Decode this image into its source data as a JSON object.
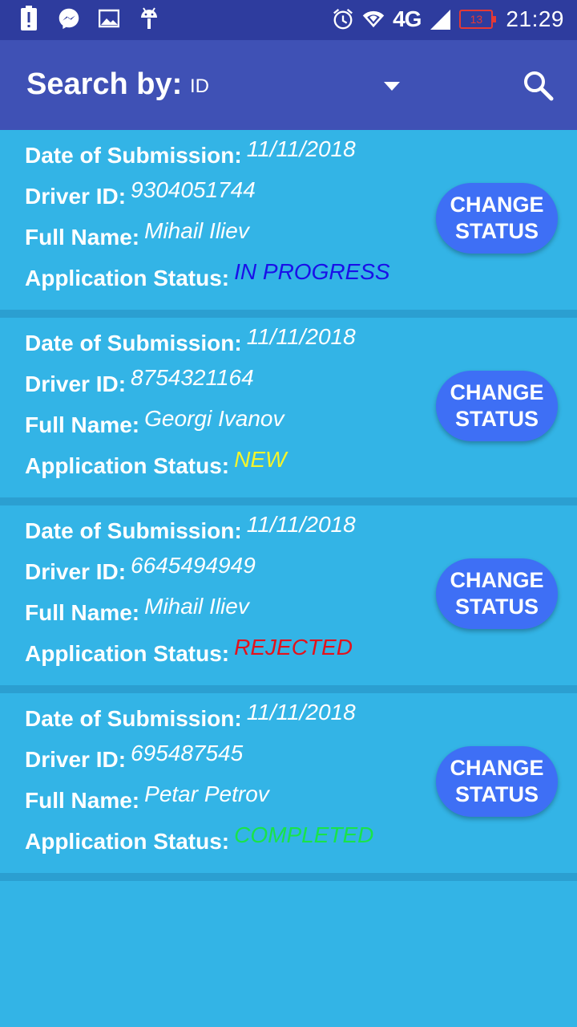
{
  "status_bar": {
    "time": "21:29",
    "network": "4G",
    "battery": "13",
    "icons": [
      "alert-icon",
      "messenger-icon",
      "image-icon",
      "android-icon",
      "alarm-icon",
      "wifi-icon",
      "signal-icon",
      "battery-icon"
    ]
  },
  "app_bar": {
    "title": "Search by:",
    "search_field": "ID",
    "icons": [
      "chevron-down-icon",
      "search-icon"
    ]
  },
  "labels": {
    "date": "Date of Submission:",
    "driver_id": "Driver ID:",
    "full_name": "Full Name:",
    "status": "Application Status:"
  },
  "applications": [
    {
      "date": "11/11/2018",
      "driver_id": "9304051744",
      "full_name": "Mihail Iliev",
      "status": "IN PROGRESS",
      "status_color": "#1a10e8",
      "button_line1": "CHANGE",
      "button_line2": "STATUS"
    },
    {
      "date": "11/11/2018",
      "driver_id": "8754321164",
      "full_name": "Georgi Ivanov",
      "status": "NEW",
      "status_color": "#f5f52a",
      "button_line1": "CHANGE",
      "button_line2": "STATUS"
    },
    {
      "date": "11/11/2018",
      "driver_id": "6645494949",
      "full_name": "Mihail Iliev",
      "status": "REJECTED",
      "status_color": "#e3121c",
      "button_line1": "CHANGE",
      "button_line2": "STATUS"
    },
    {
      "date": "11/11/2018",
      "driver_id": "695487545",
      "full_name": "Petar Petrov",
      "status": "COMPLETED",
      "status_color": "#19e34a",
      "button_line1": "CHANGE",
      "button_line2": "STATUS"
    }
  ],
  "colors": {
    "status_bar": "#2e3c9e",
    "app_bar": "#3f51b5",
    "background": "#33b4e6",
    "button": "#3e6ff5"
  }
}
